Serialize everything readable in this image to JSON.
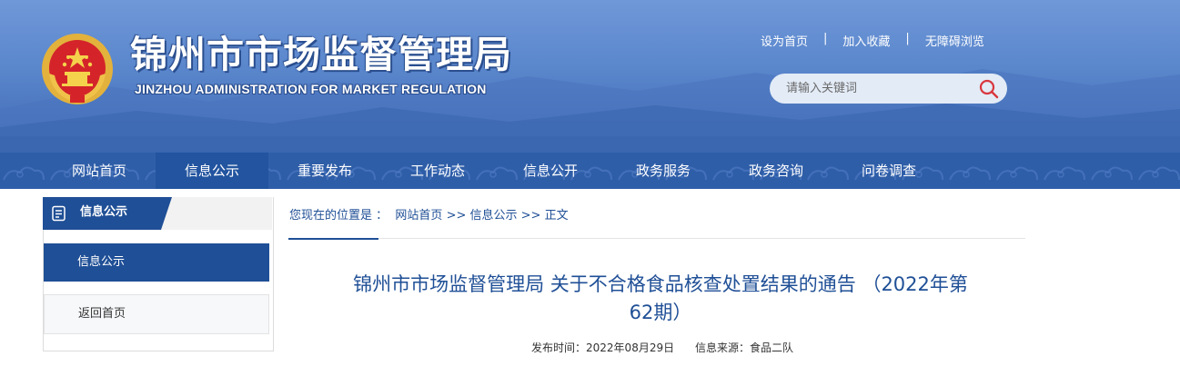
{
  "header": {
    "title": "锦州市市场监督管理局",
    "subtitle": "JINZHOU ADMINISTRATION FOR MARKET REGULATION",
    "emblem_icon": "national-emblem-icon",
    "top_links": [
      "设为首页",
      "加入收藏",
      "无障碍浏览"
    ],
    "top_link_separator": "|",
    "search": {
      "placeholder": "请输入关键词",
      "icon": "search-icon"
    }
  },
  "nav": {
    "items": [
      "网站首页",
      "信息公示",
      "重要发布",
      "工作动态",
      "信息公开",
      "政务服务",
      "政务咨询",
      "问卷调查"
    ],
    "active_index": 1
  },
  "sidebar": {
    "title": "信息公示",
    "icon": "document-list-icon",
    "items": [
      "信息公示",
      "返回首页"
    ],
    "active_index": 0
  },
  "breadcrumb": {
    "prefix": "您现在的位置是 ：",
    "items": [
      "网站首页",
      "信息公示",
      "正文"
    ],
    "separator": ">>"
  },
  "article": {
    "title_line1": "锦州市市场监督管理局 关于不合格食品核查处置结果的通告 （2022年第",
    "title_line2": "62期）",
    "publish_label": "发布时间：",
    "publish_date": "2022年08月29日",
    "source_label": "信息来源：",
    "source": "食品二队"
  },
  "colors": {
    "banner_top": "#6f98d8",
    "banner_bottom": "#3f6ab5",
    "nav_bg": "#2f5ea8",
    "accent": "#1f4f96",
    "search_bg": "#e3ebf6",
    "search_icon": "#d9363e"
  }
}
